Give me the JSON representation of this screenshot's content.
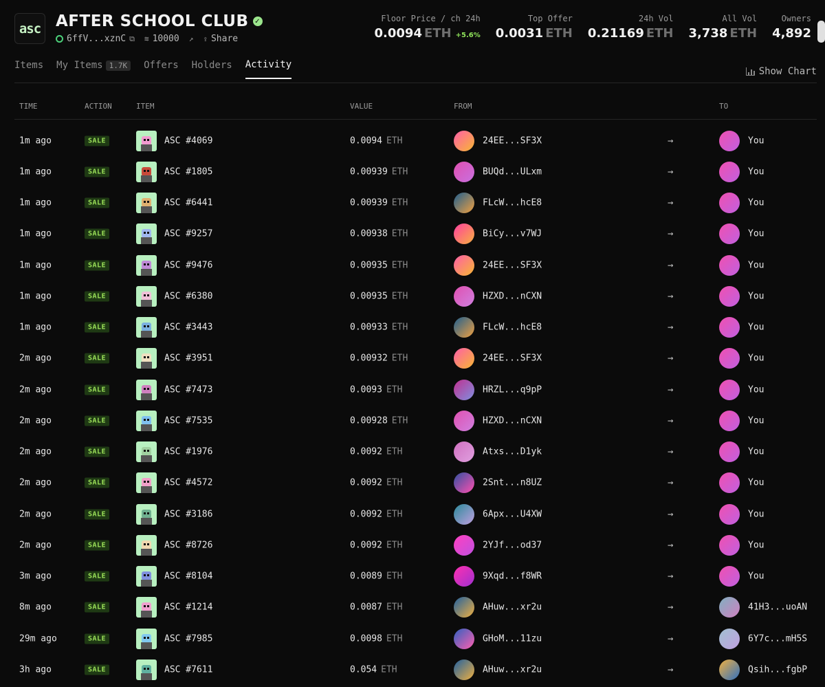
{
  "collection": {
    "logo_text": "asc",
    "title": "AFTER SCHOOL CLUB",
    "address": "6ffV...xznC",
    "supply": "10000",
    "share_label": "Share"
  },
  "stats": [
    {
      "label": "Floor Price / ch 24h",
      "value": "0.0094",
      "unit": "ETH",
      "change": "+5.6%"
    },
    {
      "label": "Top Offer",
      "value": "0.0031",
      "unit": "ETH",
      "change": ""
    },
    {
      "label": "24h Vol",
      "value": "0.21169",
      "unit": "ETH",
      "change": ""
    },
    {
      "label": "All Vol",
      "value": "3,738",
      "unit": "ETH",
      "change": ""
    },
    {
      "label": "Owners",
      "value": "4,892",
      "unit": "",
      "change": ""
    }
  ],
  "tabs": [
    {
      "label": "Items",
      "badge": ""
    },
    {
      "label": "My Items",
      "badge": "1.7K"
    },
    {
      "label": "Offers",
      "badge": ""
    },
    {
      "label": "Holders",
      "badge": ""
    },
    {
      "label": "Activity",
      "badge": "",
      "active": true
    }
  ],
  "show_chart_label": "Show Chart",
  "table": {
    "headers": {
      "time": "TIME",
      "action": "ACTION",
      "item": "ITEM",
      "value": "VALUE",
      "from": "FROM",
      "to": "TO"
    },
    "rows": [
      {
        "time": "1m ago",
        "action": "SALE",
        "item": "ASC #4069",
        "value": "0.0094",
        "unit": "ETH",
        "from": "24EE...SF3X",
        "to": "You",
        "thumb": "#f29ad0",
        "fa": [
          "#ff5ea8",
          "#f7b733"
        ],
        "ta": [
          "#f050b0",
          "#c060e0"
        ]
      },
      {
        "time": "1m ago",
        "action": "SALE",
        "item": "ASC #1805",
        "value": "0.00939",
        "unit": "ETH",
        "from": "BUQd...ULxm",
        "to": "You",
        "thumb": "#c94a3a",
        "fa": [
          "#e050b0",
          "#c870e0"
        ],
        "ta": [
          "#f050b0",
          "#c060e0"
        ]
      },
      {
        "time": "1m ago",
        "action": "SALE",
        "item": "ASC #6441",
        "value": "0.00939",
        "unit": "ETH",
        "from": "FLcW...hcE8",
        "to": "You",
        "thumb": "#e0b070",
        "fa": [
          "#1f5f8f",
          "#f0a040"
        ],
        "ta": [
          "#f050b0",
          "#c060e0"
        ]
      },
      {
        "time": "1m ago",
        "action": "SALE",
        "item": "ASC #9257",
        "value": "0.00938",
        "unit": "ETH",
        "from": "BiCy...v7WJ",
        "to": "You",
        "thumb": "#a0b8f0",
        "fa": [
          "#ff40a0",
          "#f8b040"
        ],
        "ta": [
          "#f050b0",
          "#c060e0"
        ]
      },
      {
        "time": "1m ago",
        "action": "SALE",
        "item": "ASC #9476",
        "value": "0.00935",
        "unit": "ETH",
        "from": "24EE...SF3X",
        "to": "You",
        "thumb": "#c08ad8",
        "fa": [
          "#ff5ea8",
          "#f7b733"
        ],
        "ta": [
          "#f050b0",
          "#c060e0"
        ]
      },
      {
        "time": "1m ago",
        "action": "SALE",
        "item": "ASC #6380",
        "value": "0.00935",
        "unit": "ETH",
        "from": "HZXD...nCXN",
        "to": "You",
        "thumb": "#f0c0d8",
        "fa": [
          "#e050b0",
          "#d080e0"
        ],
        "ta": [
          "#f050b0",
          "#c060e0"
        ]
      },
      {
        "time": "1m ago",
        "action": "SALE",
        "item": "ASC #3443",
        "value": "0.00933",
        "unit": "ETH",
        "from": "FLcW...hcE8",
        "to": "You",
        "thumb": "#7ab0e0",
        "fa": [
          "#1f5f8f",
          "#f0a040"
        ],
        "ta": [
          "#f050b0",
          "#c060e0"
        ]
      },
      {
        "time": "2m ago",
        "action": "SALE",
        "item": "ASC #3951",
        "value": "0.00932",
        "unit": "ETH",
        "from": "24EE...SF3X",
        "to": "You",
        "thumb": "#f0e0c0",
        "fa": [
          "#ff5ea8",
          "#f7b733"
        ],
        "ta": [
          "#f050b0",
          "#c060e0"
        ]
      },
      {
        "time": "2m ago",
        "action": "SALE",
        "item": "ASC #7473",
        "value": "0.0093",
        "unit": "ETH",
        "from": "HRZL...q9pP",
        "to": "You",
        "thumb": "#d080c0",
        "fa": [
          "#c03090",
          "#8090e0"
        ],
        "ta": [
          "#f050b0",
          "#c060e0"
        ]
      },
      {
        "time": "2m ago",
        "action": "SALE",
        "item": "ASC #7535",
        "value": "0.00928",
        "unit": "ETH",
        "from": "HZXD...nCXN",
        "to": "You",
        "thumb": "#80c0f0",
        "fa": [
          "#e050b0",
          "#d080e0"
        ],
        "ta": [
          "#f050b0",
          "#c060e0"
        ]
      },
      {
        "time": "2m ago",
        "action": "SALE",
        "item": "ASC #1976",
        "value": "0.0092",
        "unit": "ETH",
        "from": "Atxs...D1yk",
        "to": "You",
        "thumb": "#a0d0a0",
        "fa": [
          "#d070c0",
          "#e0a0e0"
        ],
        "ta": [
          "#f050b0",
          "#c060e0"
        ]
      },
      {
        "time": "2m ago",
        "action": "SALE",
        "item": "ASC #4572",
        "value": "0.0092",
        "unit": "ETH",
        "from": "2Snt...n8UZ",
        "to": "You",
        "thumb": "#f0a0c8",
        "fa": [
          "#3050a0",
          "#ff50b0"
        ],
        "ta": [
          "#f050b0",
          "#c060e0"
        ]
      },
      {
        "time": "2m ago",
        "action": "SALE",
        "item": "ASC #3186",
        "value": "0.0092",
        "unit": "ETH",
        "from": "6Apx...U4XW",
        "to": "You",
        "thumb": "#70b090",
        "fa": [
          "#2a8a9a",
          "#c0a0e0"
        ],
        "ta": [
          "#f050b0",
          "#c060e0"
        ]
      },
      {
        "time": "2m ago",
        "action": "SALE",
        "item": "ASC #8726",
        "value": "0.0092",
        "unit": "ETH",
        "from": "2YJf...od37",
        "to": "You",
        "thumb": "#f0d8b0",
        "fa": [
          "#ff40c0",
          "#c050e0"
        ],
        "ta": [
          "#f050b0",
          "#c060e0"
        ]
      },
      {
        "time": "3m ago",
        "action": "SALE",
        "item": "ASC #8104",
        "value": "0.0089",
        "unit": "ETH",
        "from": "9Xqd...f8WR",
        "to": "You",
        "thumb": "#8090e0",
        "fa": [
          "#ff30b0",
          "#a030d0"
        ],
        "ta": [
          "#f050b0",
          "#c060e0"
        ]
      },
      {
        "time": "8m ago",
        "action": "SALE",
        "item": "ASC #1214",
        "value": "0.0087",
        "unit": "ETH",
        "from": "AHuw...xr2u",
        "to": "41H3...uoAN",
        "thumb": "#f0a0d0",
        "fa": [
          "#2060a0",
          "#f0b040"
        ],
        "ta": [
          "#80b0c0",
          "#d080c0"
        ]
      },
      {
        "time": "29m ago",
        "action": "SALE",
        "item": "ASC #7985",
        "value": "0.0098",
        "unit": "ETH",
        "from": "GHoM...11zu",
        "to": "6Y7c...mH5S",
        "thumb": "#80c8f0",
        "fa": [
          "#3060c0",
          "#ff60b0"
        ],
        "ta": [
          "#a0c0d0",
          "#c0a0e0"
        ]
      },
      {
        "time": "3h ago",
        "action": "SALE",
        "item": "ASC #7611",
        "value": "0.054",
        "unit": "ETH",
        "from": "AHuw...xr2u",
        "to": "Qsih...fgbP",
        "thumb": "#60b0a0",
        "fa": [
          "#2060a0",
          "#f0b040"
        ],
        "ta": [
          "#f0b040",
          "#3070c0"
        ]
      }
    ]
  }
}
